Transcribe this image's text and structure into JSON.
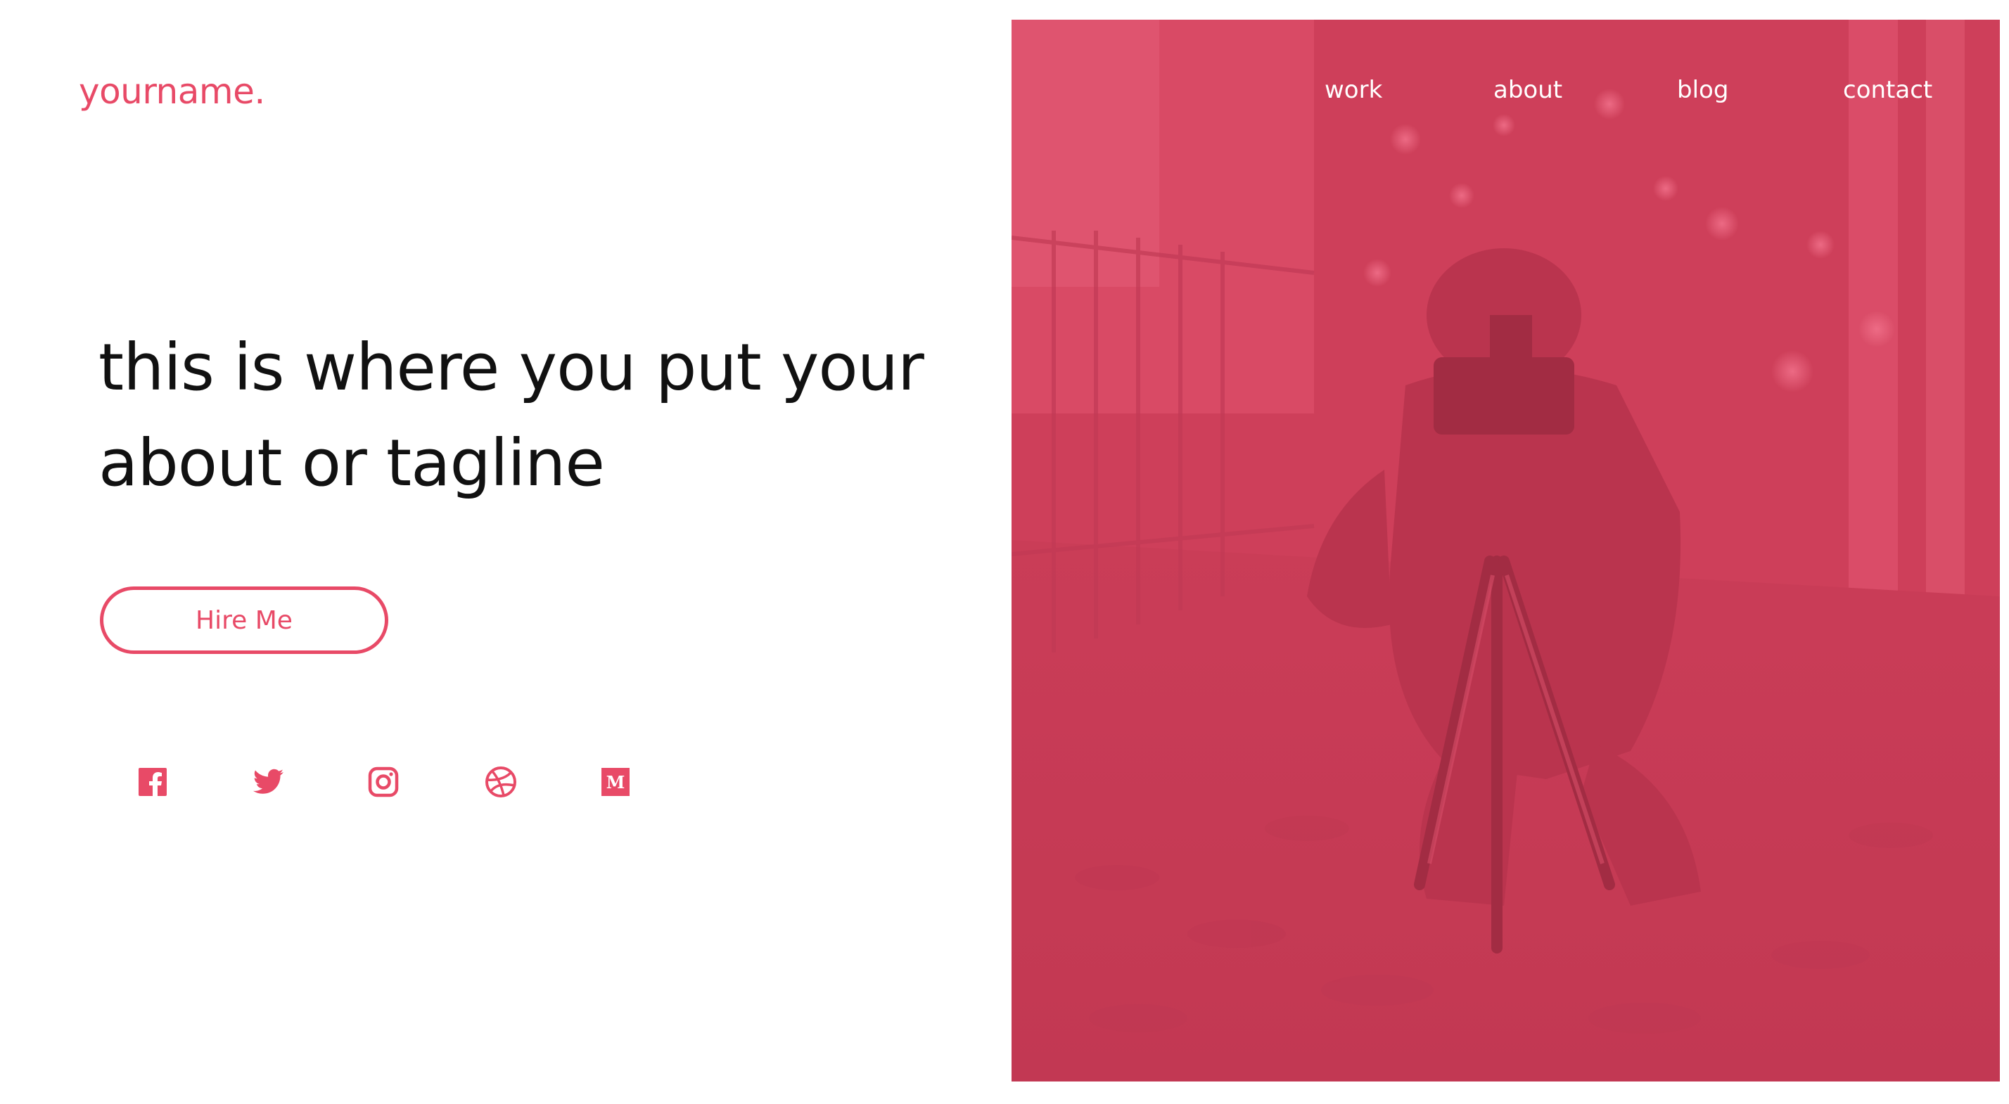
{
  "brand": {
    "logo_text": "yourname."
  },
  "hero": {
    "tagline": "this is where you put your about or tagline",
    "cta_label": "Hire Me",
    "image_icon": "photographer-photo"
  },
  "nav": {
    "items": [
      {
        "label": "work"
      },
      {
        "label": "about"
      },
      {
        "label": "blog"
      },
      {
        "label": "contact"
      }
    ]
  },
  "social": [
    {
      "icon": "facebook-icon"
    },
    {
      "icon": "twitter-icon"
    },
    {
      "icon": "instagram-icon"
    },
    {
      "icon": "dribbble-icon"
    },
    {
      "icon": "medium-icon"
    }
  ],
  "colors": {
    "accent": "#e84a67",
    "hero_overlay": "#c73d56",
    "text": "#111111",
    "nav_text": "#ffffff"
  }
}
